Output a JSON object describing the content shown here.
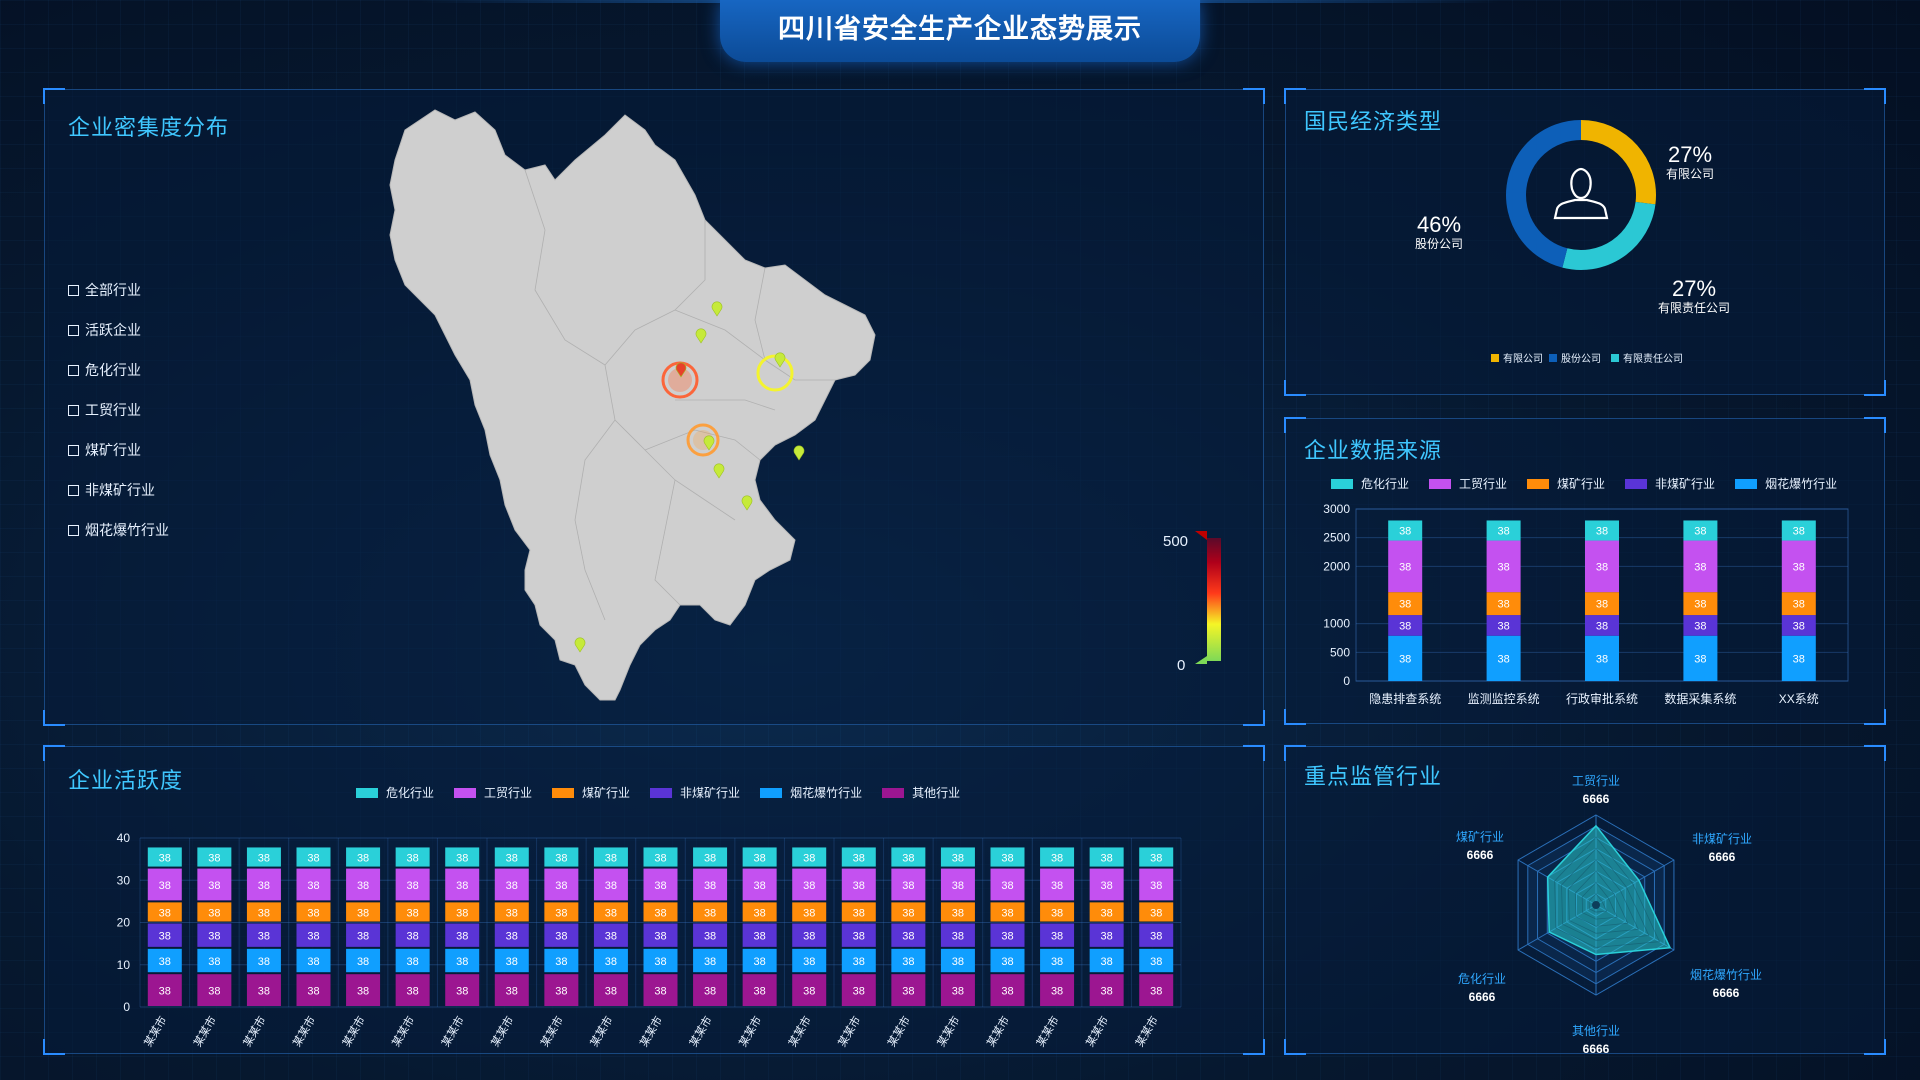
{
  "title": "四川省安全生产企业态势展示",
  "colors": {
    "danger": "#2ad0d9",
    "trade": "#c451f0",
    "coal": "#ff8c0a",
    "noncoal": "#5a34d6",
    "firework": "#109fff",
    "other": "#9c1691",
    "youxian": "#f0b400",
    "gufen": "#0d5fb8",
    "zeren": "#2bc8d4"
  },
  "density": {
    "title": "企业密集度分布",
    "filters": [
      "全部行业",
      "活跃企业",
      "危化行业",
      "工贸行业",
      "煤矿行业",
      "非煤矿行业",
      "烟花爆竹行业"
    ],
    "scale_max": "500",
    "scale_min": "0"
  },
  "economy": {
    "title": "国民经济类型",
    "icon": "user-icon",
    "slices": [
      {
        "label": "有限公司",
        "value": 27,
        "display": "27%",
        "color": "#f0b400"
      },
      {
        "label": "有限责任公司",
        "value": 27,
        "display": "27%",
        "color": "#2bc8d4"
      },
      {
        "label": "股份公司",
        "value": 46,
        "display": "46%",
        "color": "#0d5fb8"
      }
    ],
    "legend": [
      "有限公司",
      "股份公司",
      "有限责任公司"
    ]
  },
  "sources": {
    "title": "企业数据来源",
    "legend": [
      "危化行业",
      "工贸行业",
      "煤矿行业",
      "非煤矿行业",
      "烟花爆竹行业"
    ]
  },
  "activity": {
    "title": "企业活跃度",
    "legend": [
      "危化行业",
      "工贸行业",
      "煤矿行业",
      "非煤矿行业",
      "烟花爆竹行业",
      "其他行业"
    ]
  },
  "key": {
    "title": "重点监管行业",
    "axes": [
      {
        "name": "工贸行业",
        "value": "6666"
      },
      {
        "name": "非煤矿行业",
        "value": "6666"
      },
      {
        "name": "烟花爆竹行业",
        "value": "6666"
      },
      {
        "name": "其他行业",
        "value": "6666"
      },
      {
        "name": "危化行业",
        "value": "6666"
      },
      {
        "name": "煤矿行业",
        "value": "6666"
      }
    ]
  },
  "chart_data": [
    {
      "type": "bar",
      "title": "企业数据来源",
      "stacked": true,
      "categories": [
        "隐患排查系统",
        "监测监控系统",
        "行政审批系统",
        "数据采集系统",
        "XX系统"
      ],
      "yticks": [
        0,
        500,
        1000,
        2000,
        2500,
        3000
      ],
      "series": [
        {
          "name": "烟花爆竹行业",
          "values": [
            38,
            38,
            38,
            38,
            38
          ],
          "data_labels": [
            "38",
            "38",
            "38",
            "38",
            "38"
          ],
          "color": "#109fff"
        },
        {
          "name": "非煤矿行业",
          "values": [
            38,
            38,
            38,
            38,
            38
          ],
          "data_labels": [
            "38",
            "38",
            "38",
            "38",
            "38"
          ],
          "color": "#5a34d6"
        },
        {
          "name": "煤矿行业",
          "values": [
            38,
            38,
            38,
            38,
            38
          ],
          "data_labels": [
            "38",
            "38",
            "38",
            "38",
            "38"
          ],
          "color": "#ff8c0a"
        },
        {
          "name": "工贸行业",
          "values": [
            38,
            38,
            38,
            38,
            38
          ],
          "data_labels": [
            "38",
            "38",
            "38",
            "38",
            "38"
          ],
          "color": "#c451f0"
        },
        {
          "name": "危化行业",
          "values": [
            38,
            38,
            38,
            38,
            38
          ],
          "data_labels": [
            "38",
            "38",
            "38",
            "38",
            "38"
          ],
          "color": "#2ad0d9"
        }
      ],
      "note": "segment heights as drawn",
      "segment_levels": [
        790,
        1000,
        1150,
        1550,
        2450,
        2800
      ]
    },
    {
      "type": "bar",
      "title": "企业活跃度",
      "stacked": true,
      "categories": [
        "某某市",
        "某某市",
        "某某市",
        "某某市",
        "某某市",
        "某某市",
        "某某市",
        "某某市",
        "某某市",
        "某某市",
        "某某市",
        "某某市",
        "某某市",
        "某某市",
        "某某市",
        "某某市",
        "某某市",
        "某某市",
        "某某市",
        "某某市",
        "某某市"
      ],
      "ylim": [
        0,
        40
      ],
      "yticks": [
        0,
        10,
        20,
        30,
        40
      ],
      "levels": [
        0,
        8,
        14,
        20,
        25,
        33,
        38
      ],
      "series": [
        {
          "name": "其他行业",
          "label": "38",
          "color": "#9c1691"
        },
        {
          "name": "烟花爆竹行业",
          "label": "38",
          "color": "#109fff"
        },
        {
          "name": "非煤矿行业",
          "label": "38",
          "color": "#5a34d6"
        },
        {
          "name": "煤矿行业",
          "label": "38",
          "color": "#ff8c0a"
        },
        {
          "name": "工贸行业",
          "label": "38",
          "color": "#c451f0"
        },
        {
          "name": "危化行业",
          "label": "38",
          "color": "#2ad0d9"
        }
      ]
    },
    {
      "type": "pie",
      "title": "国民经济类型",
      "slices": [
        {
          "label": "有限公司",
          "value": 27
        },
        {
          "label": "有限责任公司",
          "value": 27
        },
        {
          "label": "股份公司",
          "value": 46
        }
      ]
    },
    {
      "type": "radar",
      "title": "重点监管行业",
      "axes": [
        "工贸行业",
        "非煤矿行业",
        "烟花爆竹行业",
        "其他行业",
        "危化行业",
        "煤矿行业"
      ],
      "values": [
        6666,
        6666,
        6666,
        6666,
        6666,
        6666
      ],
      "relative_shape": [
        0.88,
        0.55,
        0.95,
        0.55,
        0.6,
        0.62
      ]
    }
  ]
}
